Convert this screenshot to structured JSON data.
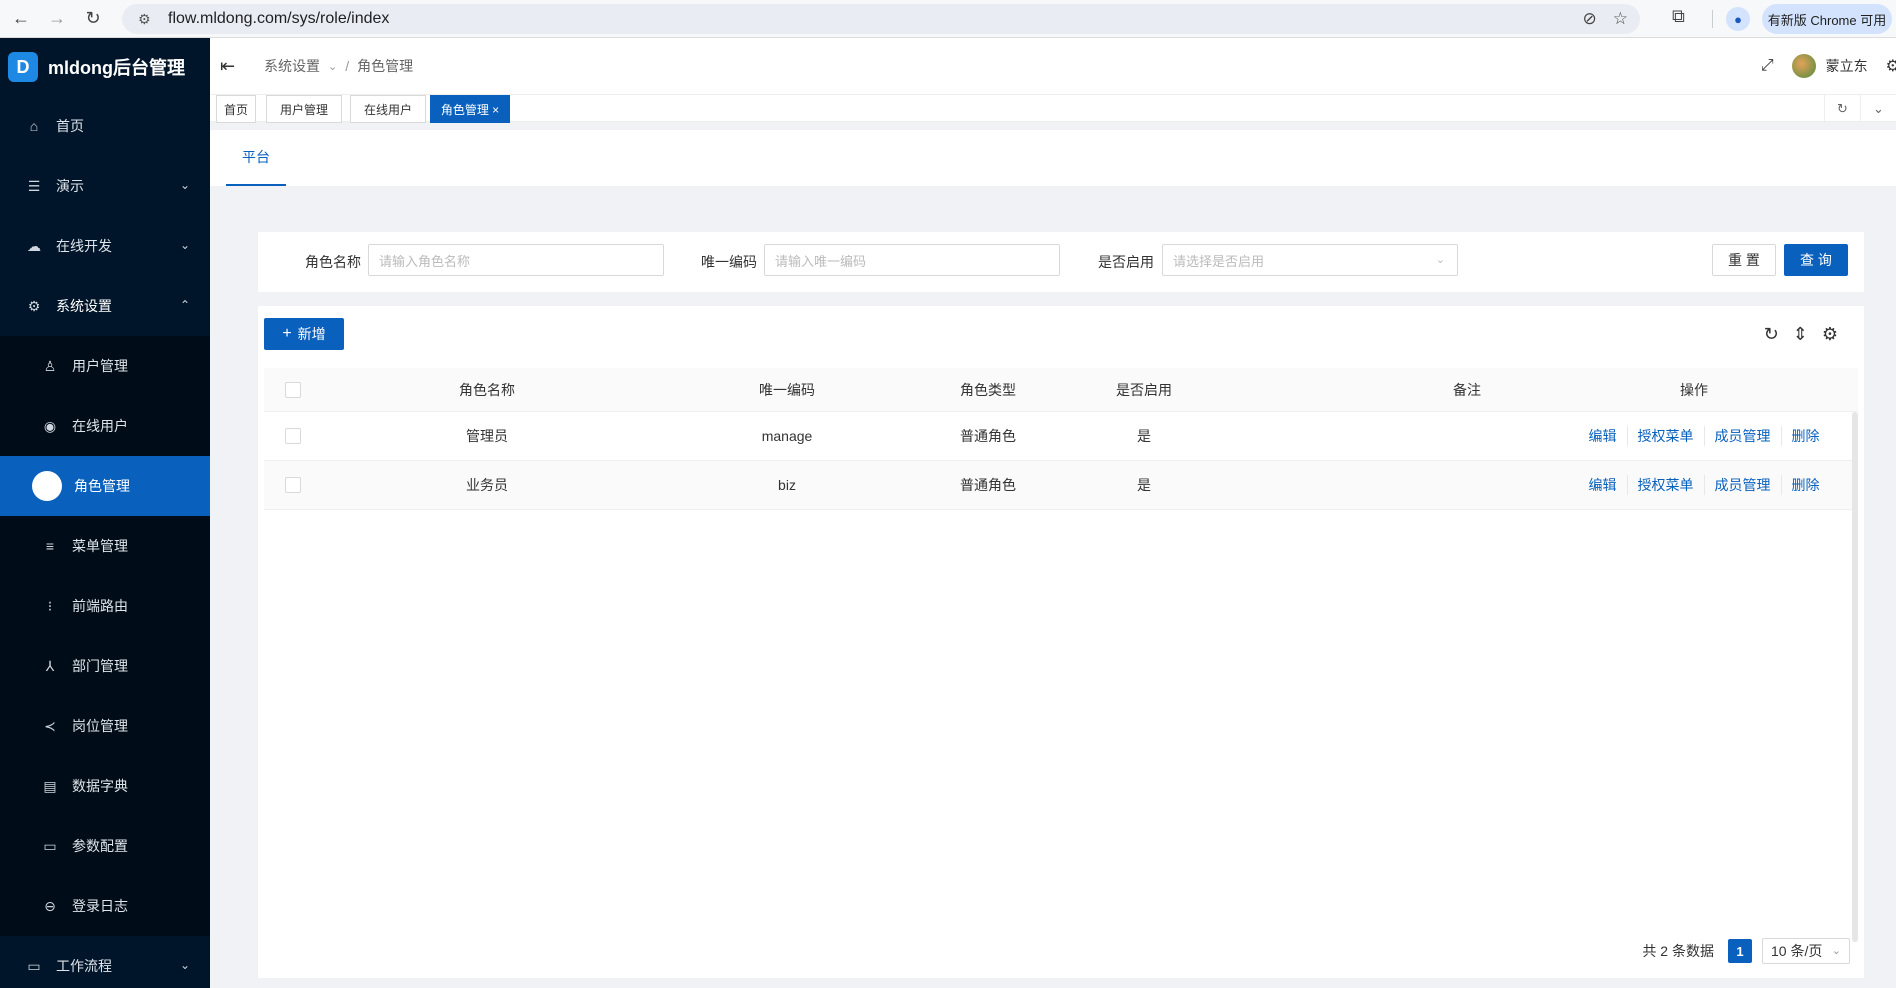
{
  "browser": {
    "url": "flow.mldong.com/sys/role/index",
    "update_label": "有新版 Chrome 可用"
  },
  "app": {
    "logo_letter": "D",
    "title": "mldong后台管理"
  },
  "sidebar": {
    "items": [
      {
        "label": "首页",
        "icon": "home-icon"
      },
      {
        "label": "演示",
        "icon": "list-icon"
      },
      {
        "label": "在线开发",
        "icon": "cloud-icon"
      },
      {
        "label": "系统设置",
        "icon": "gear-icon"
      }
    ],
    "subitems": [
      {
        "label": "用户管理",
        "icon": "user-icon"
      },
      {
        "label": "在线用户",
        "icon": "eye-icon"
      },
      {
        "label": "角色管理",
        "icon": "role-icon"
      },
      {
        "label": "菜单管理",
        "icon": "menu-icon"
      },
      {
        "label": "前端路由",
        "icon": "route-icon"
      },
      {
        "label": "部门管理",
        "icon": "dept-icon"
      },
      {
        "label": "岗位管理",
        "icon": "share-icon"
      },
      {
        "label": "数据字典",
        "icon": "book-icon"
      },
      {
        "label": "参数配置",
        "icon": "file-icon"
      },
      {
        "label": "登录日志",
        "icon": "login-icon"
      }
    ],
    "bottom_item": {
      "label": "工作流程",
      "icon": "laptop-icon"
    }
  },
  "header": {
    "breadcrumb": [
      "系统设置",
      "角色管理"
    ],
    "username": "蒙立东"
  },
  "tabs": [
    {
      "label": "首页"
    },
    {
      "label": "用户管理"
    },
    {
      "label": "在线用户"
    },
    {
      "label": "角色管理 ×"
    }
  ],
  "subtabs": {
    "active": "平台"
  },
  "search": {
    "name_label": "角色名称",
    "name_placeholder": "请输入角色名称",
    "code_label": "唯一编码",
    "code_placeholder": "请输入唯一编码",
    "enabled_label": "是否启用",
    "enabled_placeholder": "请选择是否启用",
    "reset_label": "重 置",
    "query_label": "查 询"
  },
  "table": {
    "add_label": "新增",
    "columns": [
      "角色名称",
      "唯一编码",
      "角色类型",
      "是否启用",
      "备注",
      "操作"
    ],
    "rows": [
      {
        "name": "管理员",
        "code": "manage",
        "type": "普通角色",
        "enabled": "是",
        "remark": ""
      },
      {
        "name": "业务员",
        "code": "biz",
        "type": "普通角色",
        "enabled": "是",
        "remark": ""
      }
    ],
    "actions": [
      "编辑",
      "授权菜单",
      "成员管理",
      "删除"
    ]
  },
  "pagination": {
    "total": "共 2 条数据",
    "page": "1",
    "page_size": "10 条/页"
  }
}
